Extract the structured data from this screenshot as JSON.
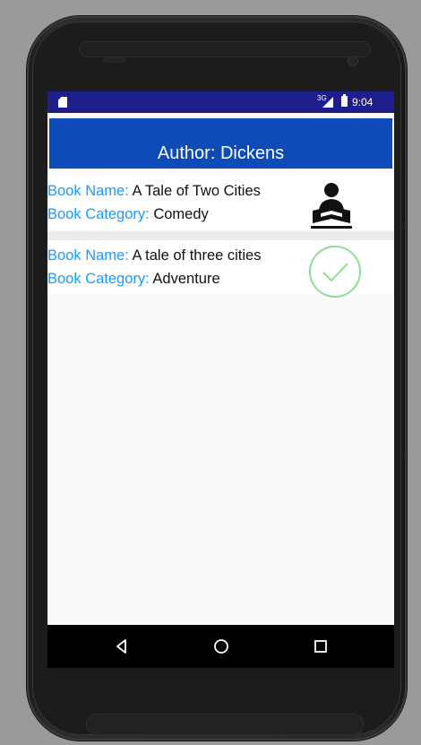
{
  "status_bar": {
    "network": "3G",
    "time": "9:04",
    "icons": [
      "sd-card-icon",
      "signal-icon",
      "battery-icon"
    ]
  },
  "header": {
    "title": "Author: Dickens",
    "background": "#0d4cb8"
  },
  "books": [
    {
      "name_label": "Book Name:",
      "name": "A Tale of Two Cities",
      "category_label": "Book Category:",
      "category": "Comedy",
      "icon": "reading-person-icon"
    },
    {
      "name_label": "Book Name:",
      "name": "A tale of three cities",
      "category_label": "Book Category:",
      "category": "Adventure",
      "icon": "check-circle-icon"
    }
  ],
  "nav_bar": {
    "buttons": [
      "back-icon",
      "home-icon",
      "recent-apps-icon"
    ]
  },
  "colors": {
    "status_bar": "#1e1e8c",
    "label": "#1a9bff",
    "check": "#8fdc9a"
  }
}
